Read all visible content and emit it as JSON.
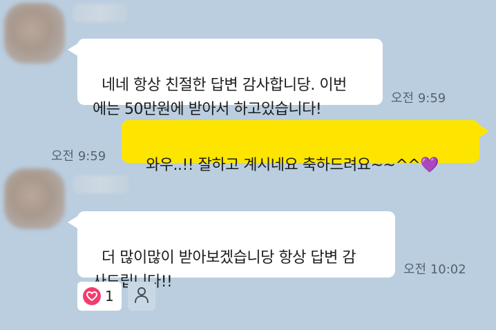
{
  "chat": {
    "messages": [
      {
        "from": "other",
        "text": "네네 항상 친절한 답변 감사합니당. 이번\n에는 50만원에 받아서 하고있습니다!",
        "time": "오전 9:59"
      },
      {
        "from": "me",
        "text": "와우..!! 잘하고 계시네요 축하드려요~~^^💜",
        "time": "오전 9:59"
      },
      {
        "from": "other",
        "text": "더 많이많이 받아보겠습니당 항상 답변 감\n사드립니다!!",
        "time": "오전 10:02"
      }
    ],
    "reaction": {
      "icon": "heart-icon",
      "count": "1",
      "color": "#f33c6e"
    }
  },
  "colors": {
    "background": "#bacee0",
    "my_bubble": "#fee500",
    "other_bubble": "#ffffff"
  }
}
